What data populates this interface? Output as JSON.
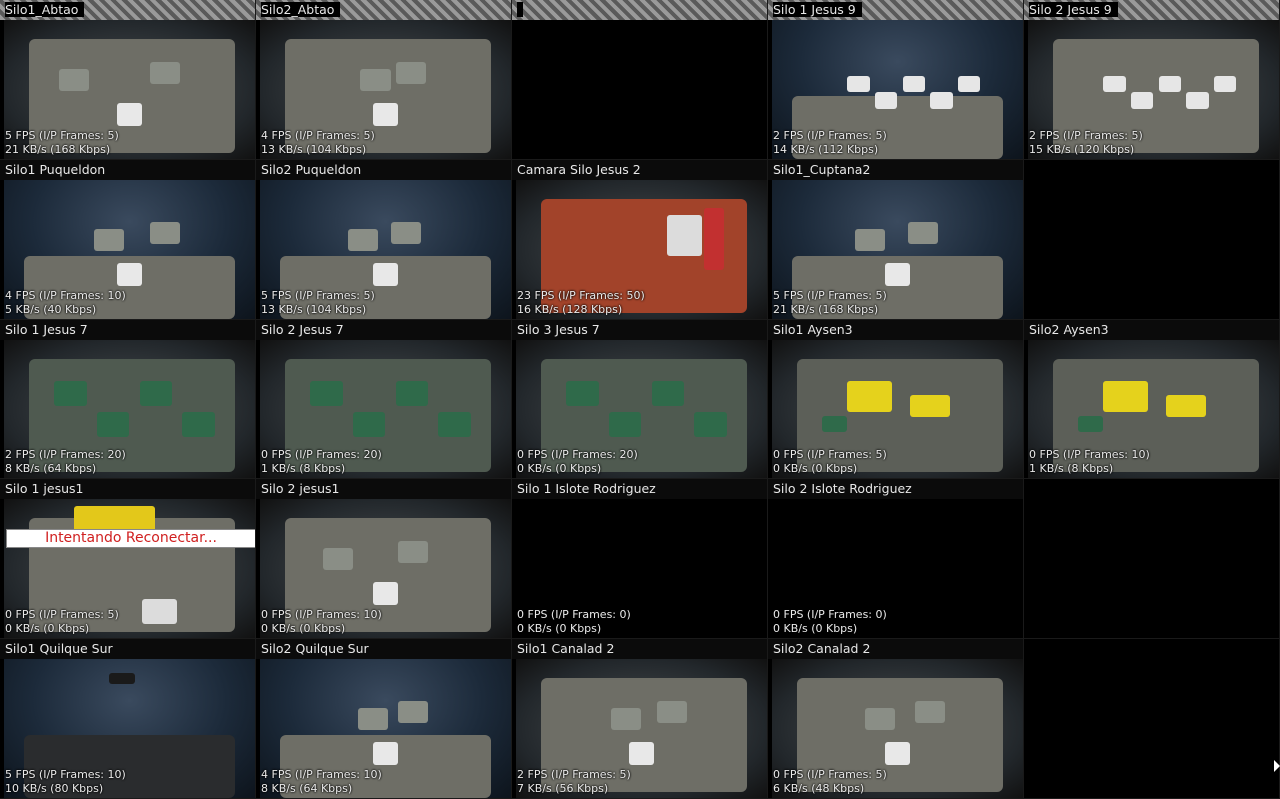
{
  "cameras": [
    {
      "name": "Silo1_Abtao",
      "stats": [
        "5 FPS (I/P Frames: 5)",
        "21 KB/s (168 Kbps)"
      ],
      "scene": "deck-grey",
      "row_header": true
    },
    {
      "name": "Silo2_Abtao",
      "stats": [
        "4 FPS (I/P Frames: 5)",
        "13 KB/s (104 Kbps)"
      ],
      "scene": "deck-grey",
      "row_header": true
    },
    {
      "name": "",
      "stats": [],
      "scene": "empty",
      "row_header": true
    },
    {
      "name": "Silo 1 Jesus 9",
      "stats": [
        "2 FPS (I/P Frames: 5)",
        "14 KB/s (112 Kbps)"
      ],
      "scene": "water-bags",
      "row_header": true
    },
    {
      "name": "Silo 2 Jesus 9",
      "stats": [
        "2 FPS (I/P Frames: 5)",
        "15 KB/s (120 Kbps)"
      ],
      "scene": "deck-bags",
      "row_header": true
    },
    {
      "name": "Silo1 Puqueldon",
      "stats": [
        "4 FPS (I/P Frames: 10)",
        "5 KB/s (40 Kbps)"
      ],
      "scene": "water-deck",
      "row_header": false
    },
    {
      "name": "Silo2 Puqueldon",
      "stats": [
        "5 FPS (I/P Frames: 5)",
        "13 KB/s (104 Kbps)"
      ],
      "scene": "water-deck",
      "row_header": false
    },
    {
      "name": "Camara Silo Jesus 2",
      "stats": [
        "23 FPS (I/P Frames: 50)",
        "16 KB/s (128 Kbps)"
      ],
      "scene": "deck-red",
      "row_header": false
    },
    {
      "name": "Silo1_Cuptana2",
      "stats": [
        "5 FPS (I/P Frames: 5)",
        "21 KB/s (168 Kbps)"
      ],
      "scene": "water-bow",
      "row_header": false
    },
    {
      "name": "",
      "stats": [],
      "scene": "empty",
      "row_header": false
    },
    {
      "name": "Silo 1 Jesus 7",
      "stats": [
        "2 FPS (I/P Frames: 20)",
        "8 KB/s (64 Kbps)"
      ],
      "scene": "deck-green",
      "row_header": false
    },
    {
      "name": "Silo 2 Jesus 7",
      "stats": [
        "0 FPS (I/P Frames: 20)",
        "1 KB/s (8 Kbps)"
      ],
      "scene": "deck-green",
      "row_header": false
    },
    {
      "name": "Silo 3 Jesus 7",
      "stats": [
        "0 FPS (I/P Frames: 20)",
        "0 KB/s (0 Kbps)"
      ],
      "scene": "deck-green",
      "row_header": false
    },
    {
      "name": "Silo1 Aysen3",
      "stats": [
        "0 FPS (I/P Frames: 5)",
        "0 KB/s (0 Kbps)"
      ],
      "scene": "deck-yellow",
      "row_header": false
    },
    {
      "name": "Silo2 Aysen3",
      "stats": [
        "0 FPS (I/P Frames: 10)",
        "1 KB/s (8 Kbps)"
      ],
      "scene": "deck-yellow",
      "row_header": false
    },
    {
      "name": "Silo 1 jesus1",
      "stats": [
        "0 FPS (I/P Frames: 5)",
        "0 KB/s (0 Kbps)"
      ],
      "scene": "deck-gen",
      "row_header": false,
      "overlay": "Intentando Reconectar..."
    },
    {
      "name": "Silo 2 jesus1",
      "stats": [
        "0 FPS (I/P Frames: 10)",
        "0 KB/s (0 Kbps)"
      ],
      "scene": "deck-grey",
      "row_header": false
    },
    {
      "name": "Silo 1 Islote Rodriguez",
      "stats": [
        "0 FPS (I/P Frames: 0)",
        "0 KB/s (0 Kbps)"
      ],
      "scene": "black",
      "row_header": false
    },
    {
      "name": "Silo 2 Islote Rodriguez",
      "stats": [
        "0 FPS (I/P Frames: 0)",
        "0 KB/s (0 Kbps)"
      ],
      "scene": "black",
      "row_header": false
    },
    {
      "name": "",
      "stats": [],
      "scene": "empty",
      "row_header": false
    },
    {
      "name": "Silo1 Quilque Sur",
      "stats": [
        "5 FPS (I/P Frames: 10)",
        "10 KB/s (80 Kbps)"
      ],
      "scene": "water-dark",
      "row_header": false
    },
    {
      "name": "Silo2 Quilque Sur",
      "stats": [
        "4 FPS (I/P Frames: 10)",
        "8 KB/s (64 Kbps)"
      ],
      "scene": "water-deck",
      "row_header": false
    },
    {
      "name": "Silo1  Canalad 2",
      "stats": [
        "2 FPS (I/P Frames: 5)",
        "7 KB/s (56 Kbps)"
      ],
      "scene": "deck-grey",
      "row_header": false
    },
    {
      "name": "Silo2  Canalad 2",
      "stats": [
        "0 FPS (I/P Frames: 5)",
        "6 KB/s (48 Kbps)"
      ],
      "scene": "deck-grey",
      "row_header": false
    },
    {
      "name": "",
      "stats": [],
      "scene": "empty",
      "row_header": false
    }
  ],
  "colors": {
    "background": "#000000",
    "title_bar": "#0b0b0b",
    "title_text": "#e8e8e8",
    "stats_text": "#eaeaea",
    "reconnect_text": "#d02020",
    "water": "#1c2a3a",
    "deck_grey": "#6e6e66",
    "deck_green": "#3c5a3a",
    "deck_red": "#a2432a"
  }
}
